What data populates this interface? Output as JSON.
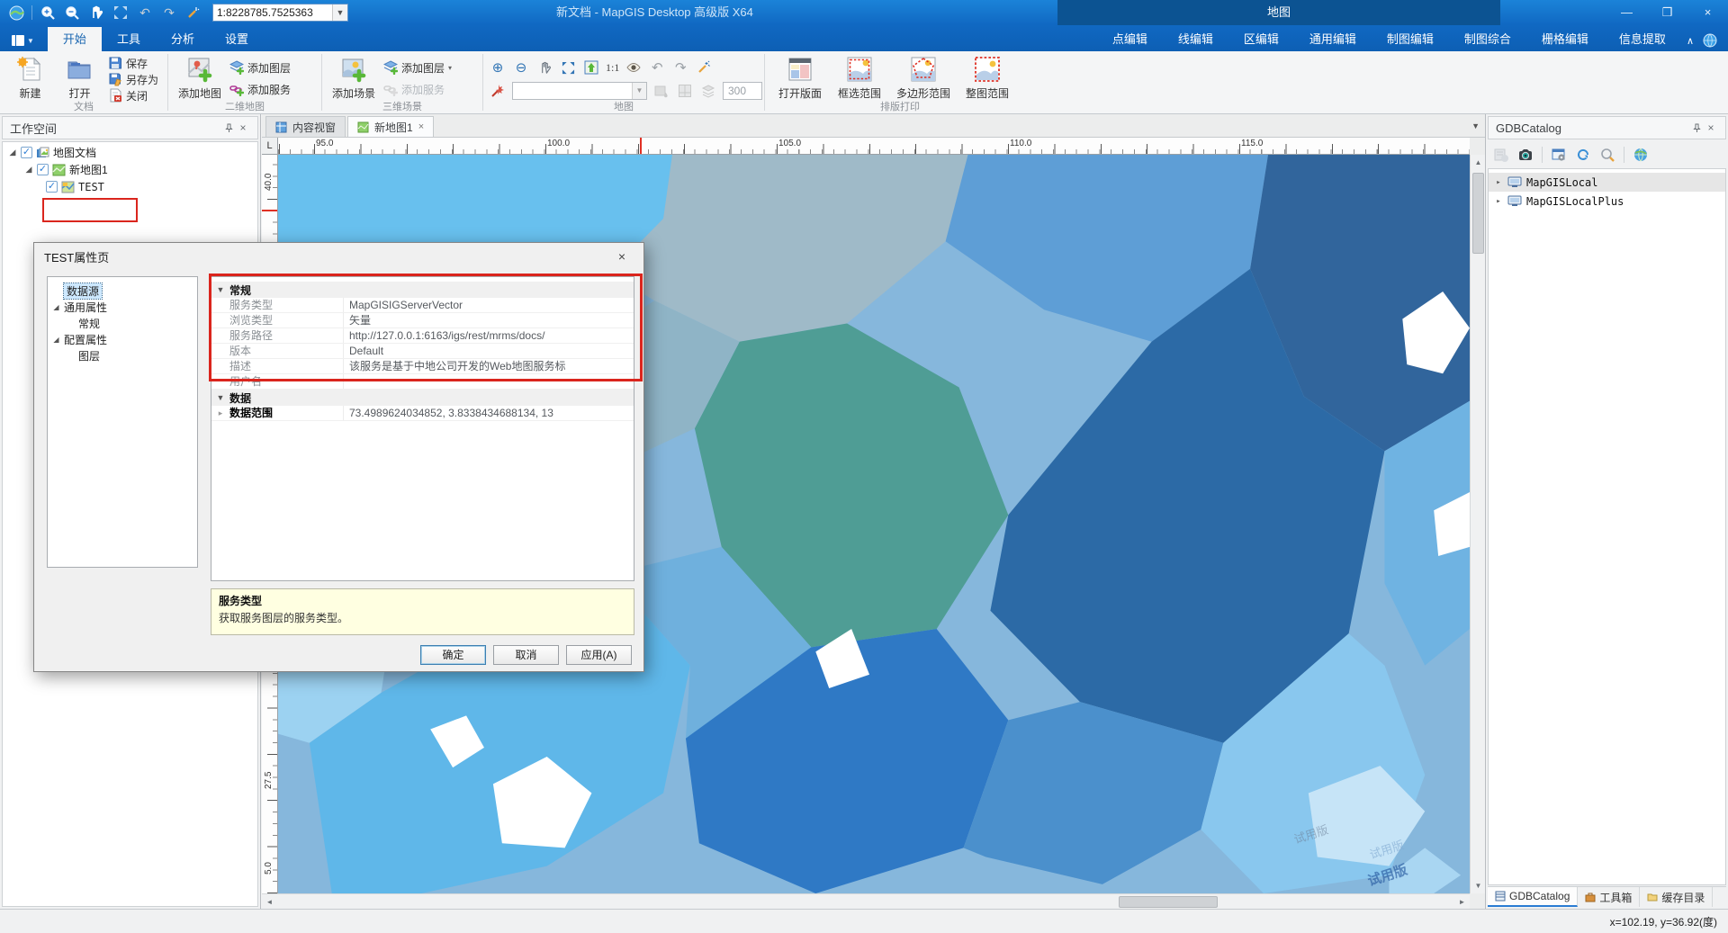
{
  "titlebar": {
    "title": "新文档 - MapGIS Desktop 高级版 X64",
    "scale_value": "1:8228785.7525363",
    "context_group_title": "地图",
    "minimize": "—",
    "maximize": "❒",
    "close": "×"
  },
  "menu": {
    "tabs": [
      "开始",
      "工具",
      "分析",
      "设置"
    ],
    "context_tabs": [
      "点编辑",
      "线编辑",
      "区编辑",
      "通用编辑",
      "制图编辑",
      "制图综合",
      "栅格编辑",
      "信息提取"
    ]
  },
  "ribbon": {
    "doc": {
      "label": "文档",
      "new": "新建",
      "open": "打开",
      "save": "保存",
      "save_as": "另存为",
      "close": "关闭"
    },
    "map2d": {
      "label": "二维地图",
      "add_map": "添加地图",
      "add_layer": "添加图层",
      "add_service": "添加服务"
    },
    "scene3d": {
      "label": "三维场景",
      "add_scene": "添加场景",
      "add_layer": "添加图层",
      "add_service": "添加服务"
    },
    "map": {
      "label": "地图",
      "ratio": "1:1",
      "dpi": "300"
    },
    "print": {
      "label": "排版打印",
      "open_layout": "打开版面",
      "rect_range": "框选范围",
      "poly_range": "多边形范围",
      "full_range": "整图范围"
    }
  },
  "workspace": {
    "title": "工作空间",
    "items": [
      "地图文档",
      "新地图1",
      "TEST"
    ]
  },
  "mapview": {
    "tabs": [
      "内容视窗",
      "新地图1"
    ],
    "close_glyph": "×",
    "corner": "L",
    "hruler": [
      "95.0",
      "100.0",
      "105.0",
      "110.0",
      "115.0"
    ],
    "vruler": [
      "40.0",
      "27.5",
      "5.0"
    ],
    "watermark": "试用版",
    "palette": [
      "#68c0ee",
      "#9fbac8",
      "#5e9ed6",
      "#31659c",
      "#4f9d95",
      "#2c6aa6",
      "#3c86cf",
      "#9cd2f1",
      "#5fb7e9",
      "#2f79c5",
      "#89c7ee",
      "#ffffff"
    ]
  },
  "dialog": {
    "title": "TEST属性页",
    "tree": {
      "datasource": "数据源",
      "general_group": "通用属性",
      "general": "常规",
      "config_group": "配置属性",
      "layer": "图层"
    },
    "grid": {
      "section_general": "常规",
      "rows": [
        {
          "label": "服务类型",
          "value": "MapGISIGServerVector"
        },
        {
          "label": "浏览类型",
          "value": "矢量"
        },
        {
          "label": "服务路径",
          "value": "http://127.0.0.1:6163/igs/rest/mrms/docs/"
        },
        {
          "label": "版本",
          "value": "Default"
        },
        {
          "label": "描述",
          "value": "该服务是基于中地公司开发的Web地图服务标"
        },
        {
          "label": "用户名",
          "value": ""
        }
      ],
      "section_data": "数据",
      "data_range_label": "数据范围",
      "data_range_value": "73.4989624034852, 3.8338434688134, 13"
    },
    "help": {
      "title": "服务类型",
      "text": "获取服务图层的服务类型。"
    },
    "buttons": {
      "ok": "确定",
      "cancel": "取消",
      "apply": "应用(A)"
    }
  },
  "gdbcatalog": {
    "title": "GDBCatalog",
    "items": [
      "MapGISLocal",
      "MapGISLocalPlus"
    ],
    "tabs": [
      "GDBCatalog",
      "工具箱",
      "缓存目录"
    ]
  },
  "statusbar": {
    "coords": "x=102.19, y=36.92(度)"
  }
}
